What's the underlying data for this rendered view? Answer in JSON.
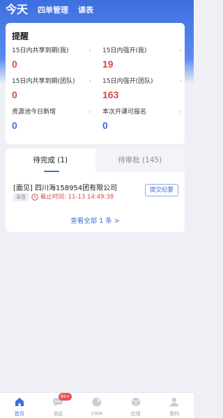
{
  "top_nav": {
    "tabs": [
      {
        "label": "今天",
        "active": true
      },
      {
        "label": "四单管理",
        "active": false
      },
      {
        "label": "课表",
        "active": false
      }
    ]
  },
  "reminder": {
    "title": "提醒",
    "stats": [
      {
        "label": "15日内共享到期(我)",
        "value": "0",
        "color": "#d24a4a"
      },
      {
        "label": "15日内强开(我)",
        "value": "19",
        "color": "#d24a4a"
      },
      {
        "label": "15日内共享到期(团队)",
        "value": "0",
        "color": "#d24a4a"
      },
      {
        "label": "15日内强开(团队)",
        "value": "163",
        "color": "#d24a4a"
      },
      {
        "label": "资源池今日新增",
        "value": "0",
        "color": "#3e6ed8"
      },
      {
        "label": "本次开课可报名",
        "value": "0",
        "color": "#3e6ed8"
      }
    ]
  },
  "tasks": {
    "tabs": [
      {
        "label": "待完成 (1)",
        "active": true
      },
      {
        "label": "待审批 (145)",
        "active": false
      }
    ],
    "item": {
      "title": "[面见] 四川海158954团有限公司",
      "tag": "录音",
      "deadline": "截止时间: 11-13 14:49:38",
      "action": "提交纪要"
    },
    "view_all": "查看全部 1 条 >"
  },
  "tabbar": {
    "items": [
      {
        "label": "首页",
        "icon": "home-icon",
        "active": true
      },
      {
        "label": "消息",
        "icon": "message-icon",
        "badge": "99+"
      },
      {
        "label": "CRM",
        "icon": "crm-icon"
      },
      {
        "label": "应用",
        "icon": "apps-icon"
      },
      {
        "label": "我的",
        "icon": "profile-icon"
      }
    ]
  },
  "colors": {
    "primary": "#3e6ed8",
    "alert": "#d24a4a",
    "header_gradient_top": "#3d6fe0"
  }
}
